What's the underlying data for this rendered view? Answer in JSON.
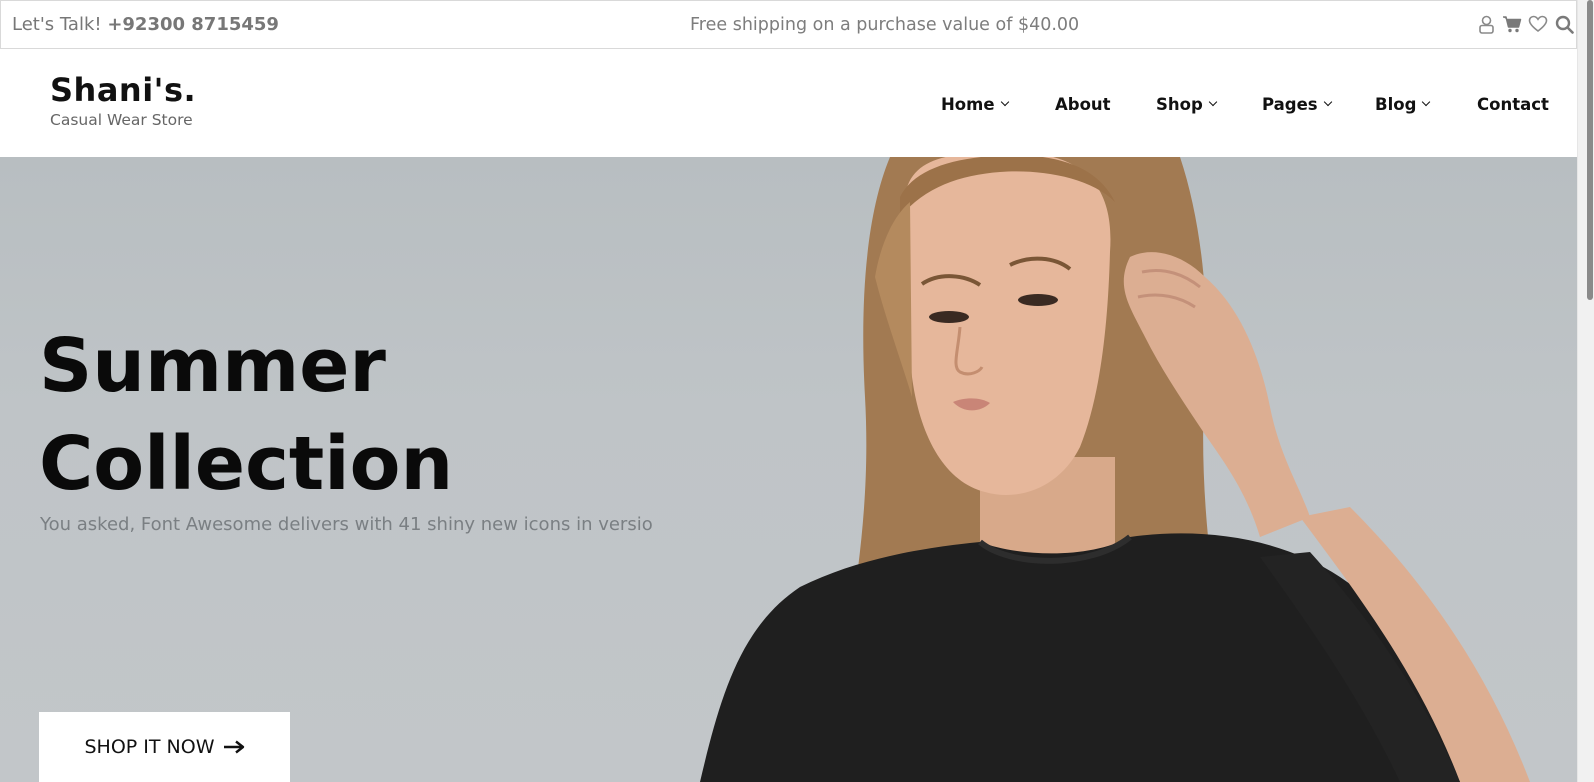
{
  "topbar": {
    "talk_prefix": "Let's Talk! ",
    "phone": "+92300 8715459",
    "shipping": "Free shipping on a purchase value of $40.00",
    "icons": [
      "user-icon",
      "cart-icon",
      "heart-icon",
      "search-icon"
    ]
  },
  "brand": {
    "name": "Shani's.",
    "tagline": "Casual Wear Store"
  },
  "nav": {
    "items": [
      {
        "label": "Home",
        "dropdown": true
      },
      {
        "label": "About",
        "dropdown": false
      },
      {
        "label": "Shop",
        "dropdown": true
      },
      {
        "label": "Pages",
        "dropdown": true
      },
      {
        "label": "Blog",
        "dropdown": true
      },
      {
        "label": "Contact",
        "dropdown": false
      }
    ]
  },
  "hero": {
    "title_line1": "Summer",
    "title_line2": "Collection",
    "subtitle": "You asked, Font Awesome delivers with 41 shiny new icons in versio",
    "cta_label": "SHOP IT NOW"
  },
  "colors": {
    "hero_background": "#bec3c6",
    "text_dark": "#111111",
    "text_muted": "#7a7f83"
  }
}
